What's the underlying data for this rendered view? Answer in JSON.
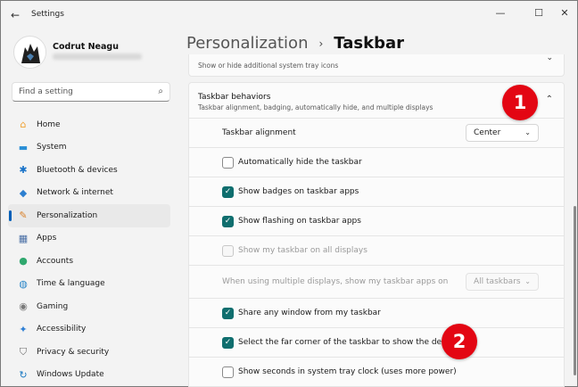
{
  "window": {
    "title": "Settings",
    "back_glyph": "←",
    "min_glyph": "—",
    "max_glyph": "☐",
    "close_glyph": "✕"
  },
  "user": {
    "name": "Codrut Neagu"
  },
  "search": {
    "placeholder": "Find a setting",
    "icon": "search-icon"
  },
  "nav": [
    {
      "label": "Home",
      "icon": "home-icon",
      "glyph": "⌂",
      "color": "#f0a030"
    },
    {
      "label": "System",
      "icon": "monitor-icon",
      "glyph": "▬",
      "color": "#2b8fd6"
    },
    {
      "label": "Bluetooth & devices",
      "icon": "bluetooth-icon",
      "glyph": "✱",
      "color": "#1a73c8"
    },
    {
      "label": "Network & internet",
      "icon": "wifi-icon",
      "glyph": "◆",
      "color": "#2c7fd0"
    },
    {
      "label": "Personalization",
      "icon": "brush-icon",
      "glyph": "✎",
      "color": "#d9822b",
      "active": true
    },
    {
      "label": "Apps",
      "icon": "apps-icon",
      "glyph": "▦",
      "color": "#4a6fa5"
    },
    {
      "label": "Accounts",
      "icon": "person-icon",
      "glyph": "●",
      "color": "#2fa86e"
    },
    {
      "label": "Time & language",
      "icon": "globe-clock-icon",
      "glyph": "◍",
      "color": "#2a86c8"
    },
    {
      "label": "Gaming",
      "icon": "controller-icon",
      "glyph": "◉",
      "color": "#7a7a7a"
    },
    {
      "label": "Accessibility",
      "icon": "accessibility-icon",
      "glyph": "✦",
      "color": "#2f7fd4"
    },
    {
      "label": "Privacy & security",
      "icon": "shield-icon",
      "glyph": "⛉",
      "color": "#6b6b6b"
    },
    {
      "label": "Windows Update",
      "icon": "update-icon",
      "glyph": "↻",
      "color": "#1a78c2"
    }
  ],
  "header": {
    "parent": "Personalization",
    "separator": "›",
    "current": "Taskbar"
  },
  "prev_card": {
    "subtitle": "Show or hide additional system tray icons",
    "chevron": "⌄"
  },
  "behaviors": {
    "title": "Taskbar behaviors",
    "subtitle": "Taskbar alignment, badging, automatically hide, and multiple displays",
    "chevron": "⌃",
    "alignment": {
      "label": "Taskbar alignment",
      "value": "Center",
      "arrow": "⌄"
    },
    "options": [
      {
        "label": "Automatically hide the taskbar",
        "state": "unchecked"
      },
      {
        "label": "Show badges on taskbar apps",
        "state": "checked"
      },
      {
        "label": "Show flashing on taskbar apps",
        "state": "checked"
      },
      {
        "label": "Show my taskbar on all displays",
        "state": "disabled"
      }
    ],
    "multi_display": {
      "label": "When using multiple displays, show my taskbar apps on",
      "value": "All taskbars",
      "arrow": "⌄"
    },
    "options2": [
      {
        "label": "Share any window from my taskbar",
        "state": "checked"
      },
      {
        "label": "Select the far corner of the taskbar to show the desktop",
        "state": "checked"
      },
      {
        "label": "Show seconds in system tray clock (uses more power)",
        "state": "unchecked"
      }
    ]
  },
  "markers": {
    "first": "1",
    "second": "2",
    "color": "#e30613"
  },
  "check_glyph": "✓"
}
